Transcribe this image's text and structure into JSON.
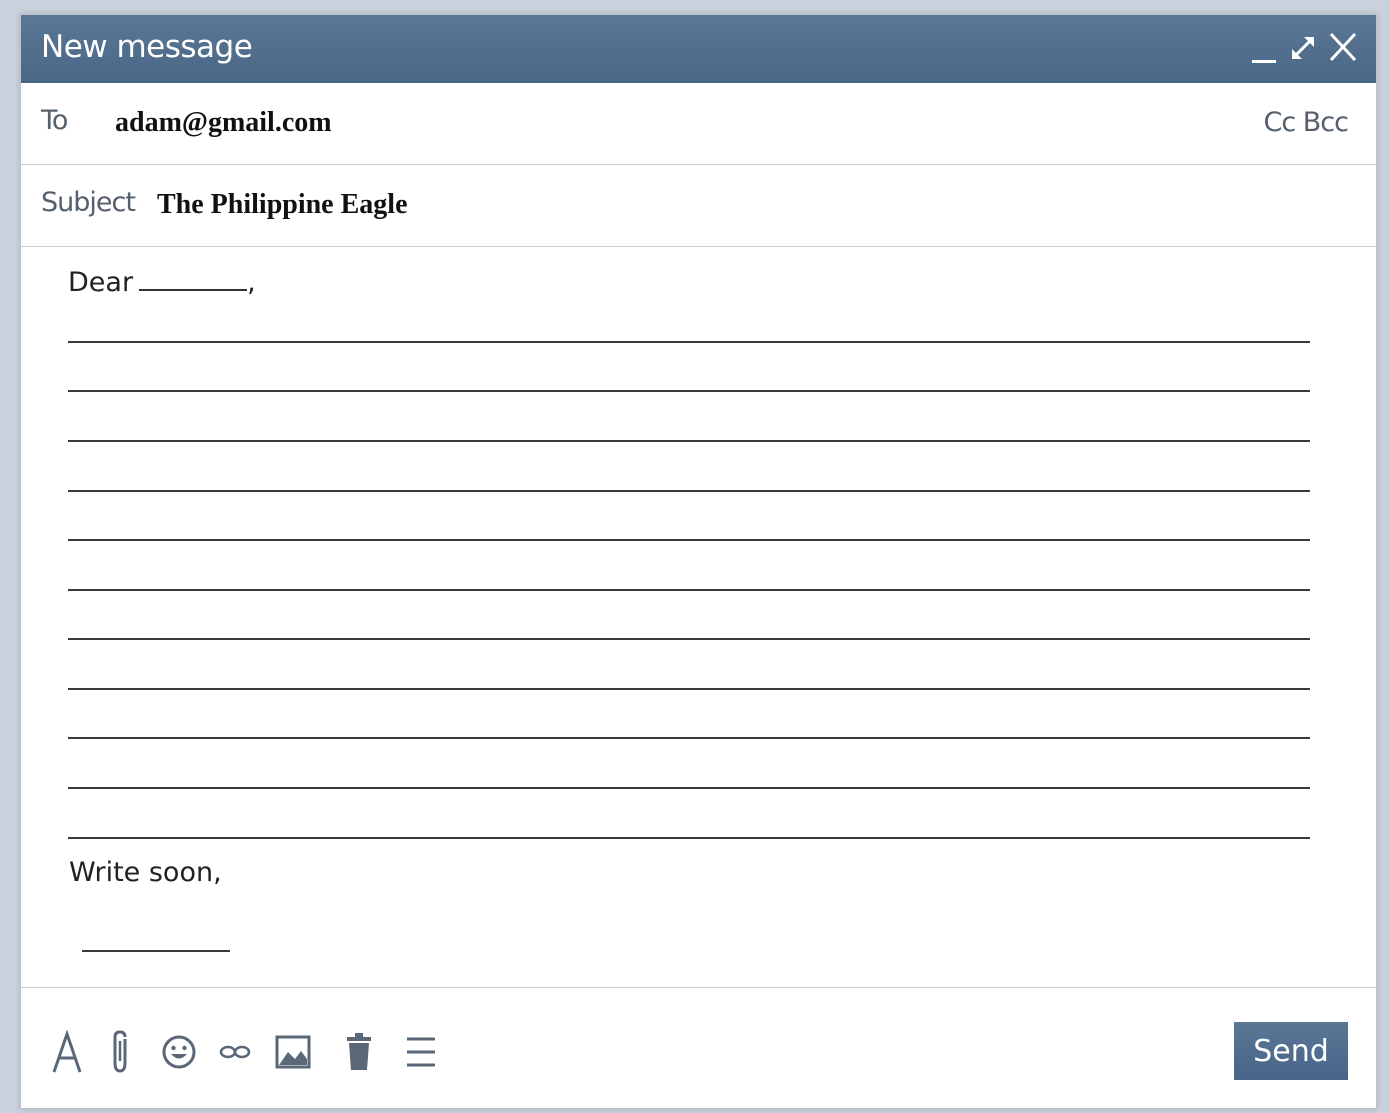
{
  "window": {
    "title": "New message",
    "controls": [
      "minimize-icon",
      "expand-icon",
      "close-icon"
    ]
  },
  "to": {
    "label": "To",
    "value": "adam@gmail.com",
    "cc_bcc": "Cc Bcc"
  },
  "subject": {
    "label": "Subject",
    "value": "The Philippine Eagle"
  },
  "body": {
    "greeting": "Dear",
    "greeting_suffix": ",",
    "blank_lines": 11,
    "closing": "Write soon,"
  },
  "toolbar": {
    "icons": [
      "text-format-icon",
      "attachment-icon",
      "emoji-icon",
      "link-icon",
      "image-icon",
      "trash-icon",
      "more-options-icon"
    ],
    "send_label": "Send"
  },
  "colors": {
    "titlebar": "#4f6d8c",
    "send_button": "#4f6d8c",
    "label_text": "#55606c"
  }
}
